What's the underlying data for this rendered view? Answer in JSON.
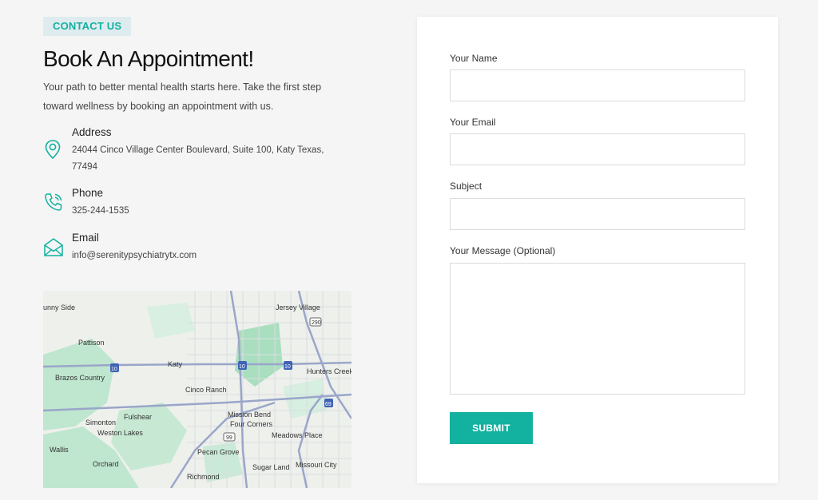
{
  "header": {
    "tag": "CONTACT US",
    "title": "Book An Appointment!",
    "intro": "Your path to better mental health starts here. Take the first step toward wellness by booking an appointment with us."
  },
  "contact": {
    "address": {
      "label": "Address",
      "value": "24044 Cinco Village Center Boulevard, Suite 100, Katy Texas, 77494",
      "icon": "map-pin-icon"
    },
    "phone": {
      "label": "Phone",
      "value": "325-244-1535",
      "icon": "phone-icon"
    },
    "email": {
      "label": "Email",
      "value": "info@serenitypsychiatrytx.com",
      "icon": "envelope-icon"
    }
  },
  "map": {
    "places": [
      "unny Side",
      "Jersey Village",
      "Pattison",
      "Katy",
      "Brazos Country",
      "Hunters Creek Village",
      "Cinco Ranch",
      "Fulshear",
      "Simonton",
      "Weston Lakes",
      "Mission Bend",
      "Four Corners",
      "Meadows Place",
      "Wallis",
      "Pecan Grove",
      "Orchard",
      "Sugar Land",
      "Missouri City",
      "Richmond"
    ],
    "shields": [
      "290",
      "10",
      "10",
      "10",
      "69",
      "99"
    ]
  },
  "form": {
    "name_label": "Your Name",
    "email_label": "Your Email",
    "subject_label": "Subject",
    "message_label": "Your Message (Optional)",
    "submit_label": "SUBMIT"
  },
  "colors": {
    "accent": "#12b1a0",
    "tag_bg": "#dfecef",
    "page_bg": "#f5f5f5"
  }
}
